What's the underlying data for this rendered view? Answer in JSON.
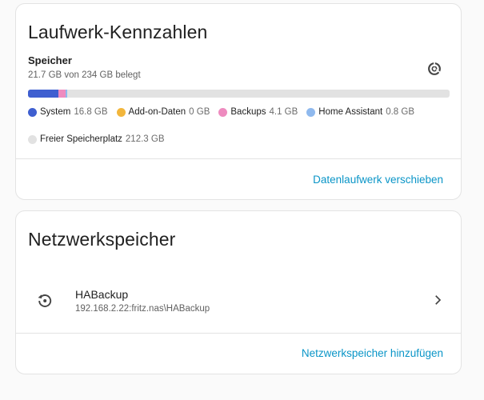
{
  "storage_card": {
    "title": "Laufwerk-Kennzahlen",
    "section_label": "Speicher",
    "usage_text": "21.7 GB von 234 GB belegt",
    "chart_icon": "chart-donut-icon",
    "bar_segments": [
      {
        "name": "System",
        "value_gb": 16.8,
        "color": "#3f5fd0"
      },
      {
        "name": "Add-on-Daten",
        "value_gb": 0,
        "color": "#f2b63c"
      },
      {
        "name": "Backups",
        "value_gb": 4.1,
        "color": "#ee8bbf"
      },
      {
        "name": "Home Assistant",
        "value_gb": 0.8,
        "color": "#8fb9ee"
      }
    ],
    "total_gb": 234,
    "legend": [
      {
        "name": "System",
        "value": "16.8 GB",
        "color": "#3f5fd0"
      },
      {
        "name": "Add-on-Daten",
        "value": "0 GB",
        "color": "#f2b63c"
      },
      {
        "name": "Backups",
        "value": "4.1 GB",
        "color": "#ee8bbf"
      },
      {
        "name": "Home Assistant",
        "value": "0.8 GB",
        "color": "#8fb9ee"
      },
      {
        "name": "Freier Speicherplatz",
        "value": "212.3 GB",
        "color": "#e2e2e2"
      }
    ],
    "action_label": "Datenlaufwerk verschieben"
  },
  "network_card": {
    "title": "Netzwerkspeicher",
    "share": {
      "icon": "backup-restore-icon",
      "name": "HABackup",
      "path": "192.168.2.22:fritz.nas\\HABackup"
    },
    "action_label": "Netzwerkspeicher hinzufügen"
  },
  "colors": {
    "accent": "#0a95c7",
    "card_border": "#e3e3e3",
    "background": "#fafafa"
  }
}
